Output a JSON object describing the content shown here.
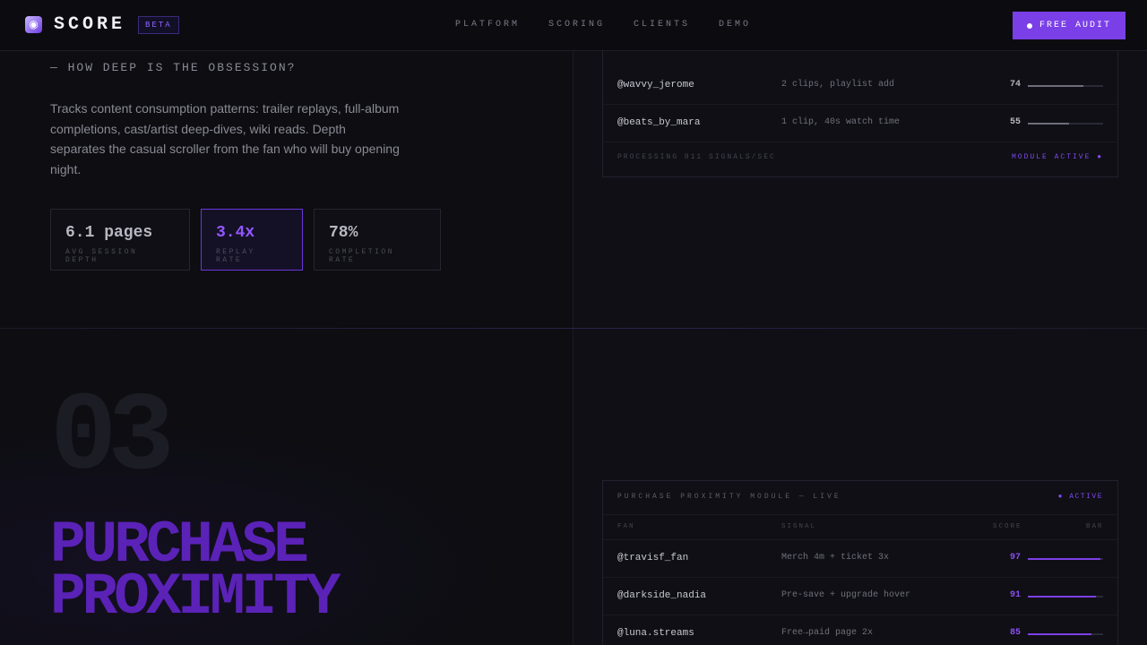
{
  "nav": {
    "brand": "SCORE",
    "beta": "BETA",
    "links": [
      "PLATFORM",
      "SCORING",
      "CLIENTS",
      "DEMO"
    ],
    "cta": "FREE AUDIT"
  },
  "depth": {
    "question": "— HOW DEEP IS THE OBSESSION?",
    "description": "Tracks content consumption patterns: trailer replays, full-album completions, cast/artist deep-dives, wiki reads. Depth separates the casual scroller from the fan who will buy opening night.",
    "stats": [
      {
        "value": "6.1 pages",
        "label": "AVG SESSION DEPTH"
      },
      {
        "value": "3.4x",
        "label": "REPLAY RATE"
      },
      {
        "value": "78%",
        "label": "COMPLETION RATE"
      }
    ],
    "panel": {
      "rows": [
        {
          "handle": "@wavvy_jerome",
          "signal": "2 clips, playlist add",
          "score": "74",
          "bar": 0.74
        },
        {
          "handle": "@beats_by_mara",
          "signal": "1 clip, 40s watch time",
          "score": "55",
          "bar": 0.55
        }
      ],
      "footer": "PROCESSING 811 SIGNALS/SEC",
      "status": "MODULE ACTIVE ●"
    }
  },
  "section3": {
    "number": "03",
    "title_line1": "PURCHASE",
    "title_line2": "PROXIMITY",
    "panel": {
      "title": "PURCHASE PROXIMITY MODULE — LIVE",
      "status": "● ACTIVE",
      "columns": [
        "FAN",
        "SIGNAL",
        "SCORE",
        "BAR"
      ],
      "rows": [
        {
          "handle": "@travisf_fan",
          "signal": "Merch 4m + ticket 3x",
          "score": "97",
          "bar": 0.97
        },
        {
          "handle": "@darkside_nadia",
          "signal": "Pre-save + upgrade hover",
          "score": "91",
          "bar": 0.91
        },
        {
          "handle": "@luna.streams",
          "signal": "Free→paid page 2x",
          "score": "85",
          "bar": 0.85
        }
      ]
    }
  },
  "colors": {
    "accent": "#7b3fe8",
    "accent_text": "#8c4ef5",
    "title_purple": "#5b22b8",
    "background": "#0d0d12"
  }
}
